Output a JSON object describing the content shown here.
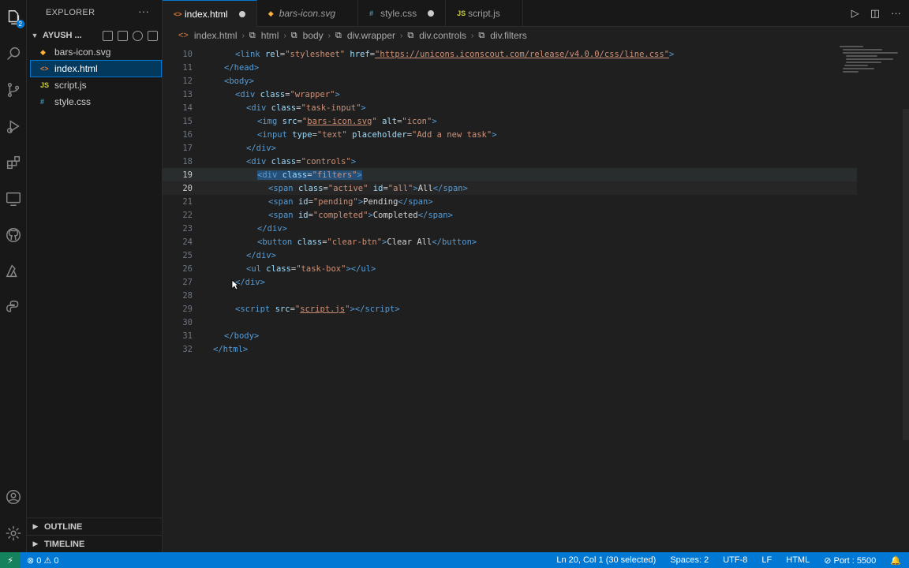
{
  "explorer": {
    "title": "EXPLORER",
    "more": "···",
    "folder": "AYUSH ...",
    "files": [
      {
        "name": "bars-icon.svg",
        "icon": "◆"
      },
      {
        "name": "index.html",
        "icon": "<>"
      },
      {
        "name": "script.js",
        "icon": "JS"
      },
      {
        "name": "style.css",
        "icon": "#"
      }
    ],
    "outline": "OUTLINE",
    "timeline": "TIMELINE"
  },
  "tabs": [
    {
      "name": "index.html",
      "icon": "<>"
    },
    {
      "name": "bars-icon.svg",
      "icon": "◆"
    },
    {
      "name": "style.css",
      "icon": "#"
    },
    {
      "name": "script.js",
      "icon": "JS"
    }
  ],
  "breadcrumb": [
    "index.html",
    "html",
    "body",
    "div.wrapper",
    "div.controls",
    "div.filters"
  ],
  "editor": {
    "line_numbers": [
      "10",
      "11",
      "12",
      "13",
      "14",
      "15",
      "16",
      "17",
      "18",
      "19",
      "20",
      "21",
      "22",
      "23",
      "24",
      "25",
      "26",
      "27",
      "28",
      "29",
      "30",
      "31",
      "32"
    ]
  },
  "status": {
    "remote": "⚡",
    "problems": "⊗ 0 ⚠ 0",
    "position": "Ln 20, Col 1 (30 selected)",
    "spaces": "Spaces: 2",
    "encoding": "UTF-8",
    "eol": "LF",
    "language": "HTML",
    "port": "⊘ Port : 5500",
    "bell": "🔔"
  },
  "colors": {
    "accent": "#0078d4",
    "status_bg": "#0078d4",
    "selection": "#04395e"
  }
}
